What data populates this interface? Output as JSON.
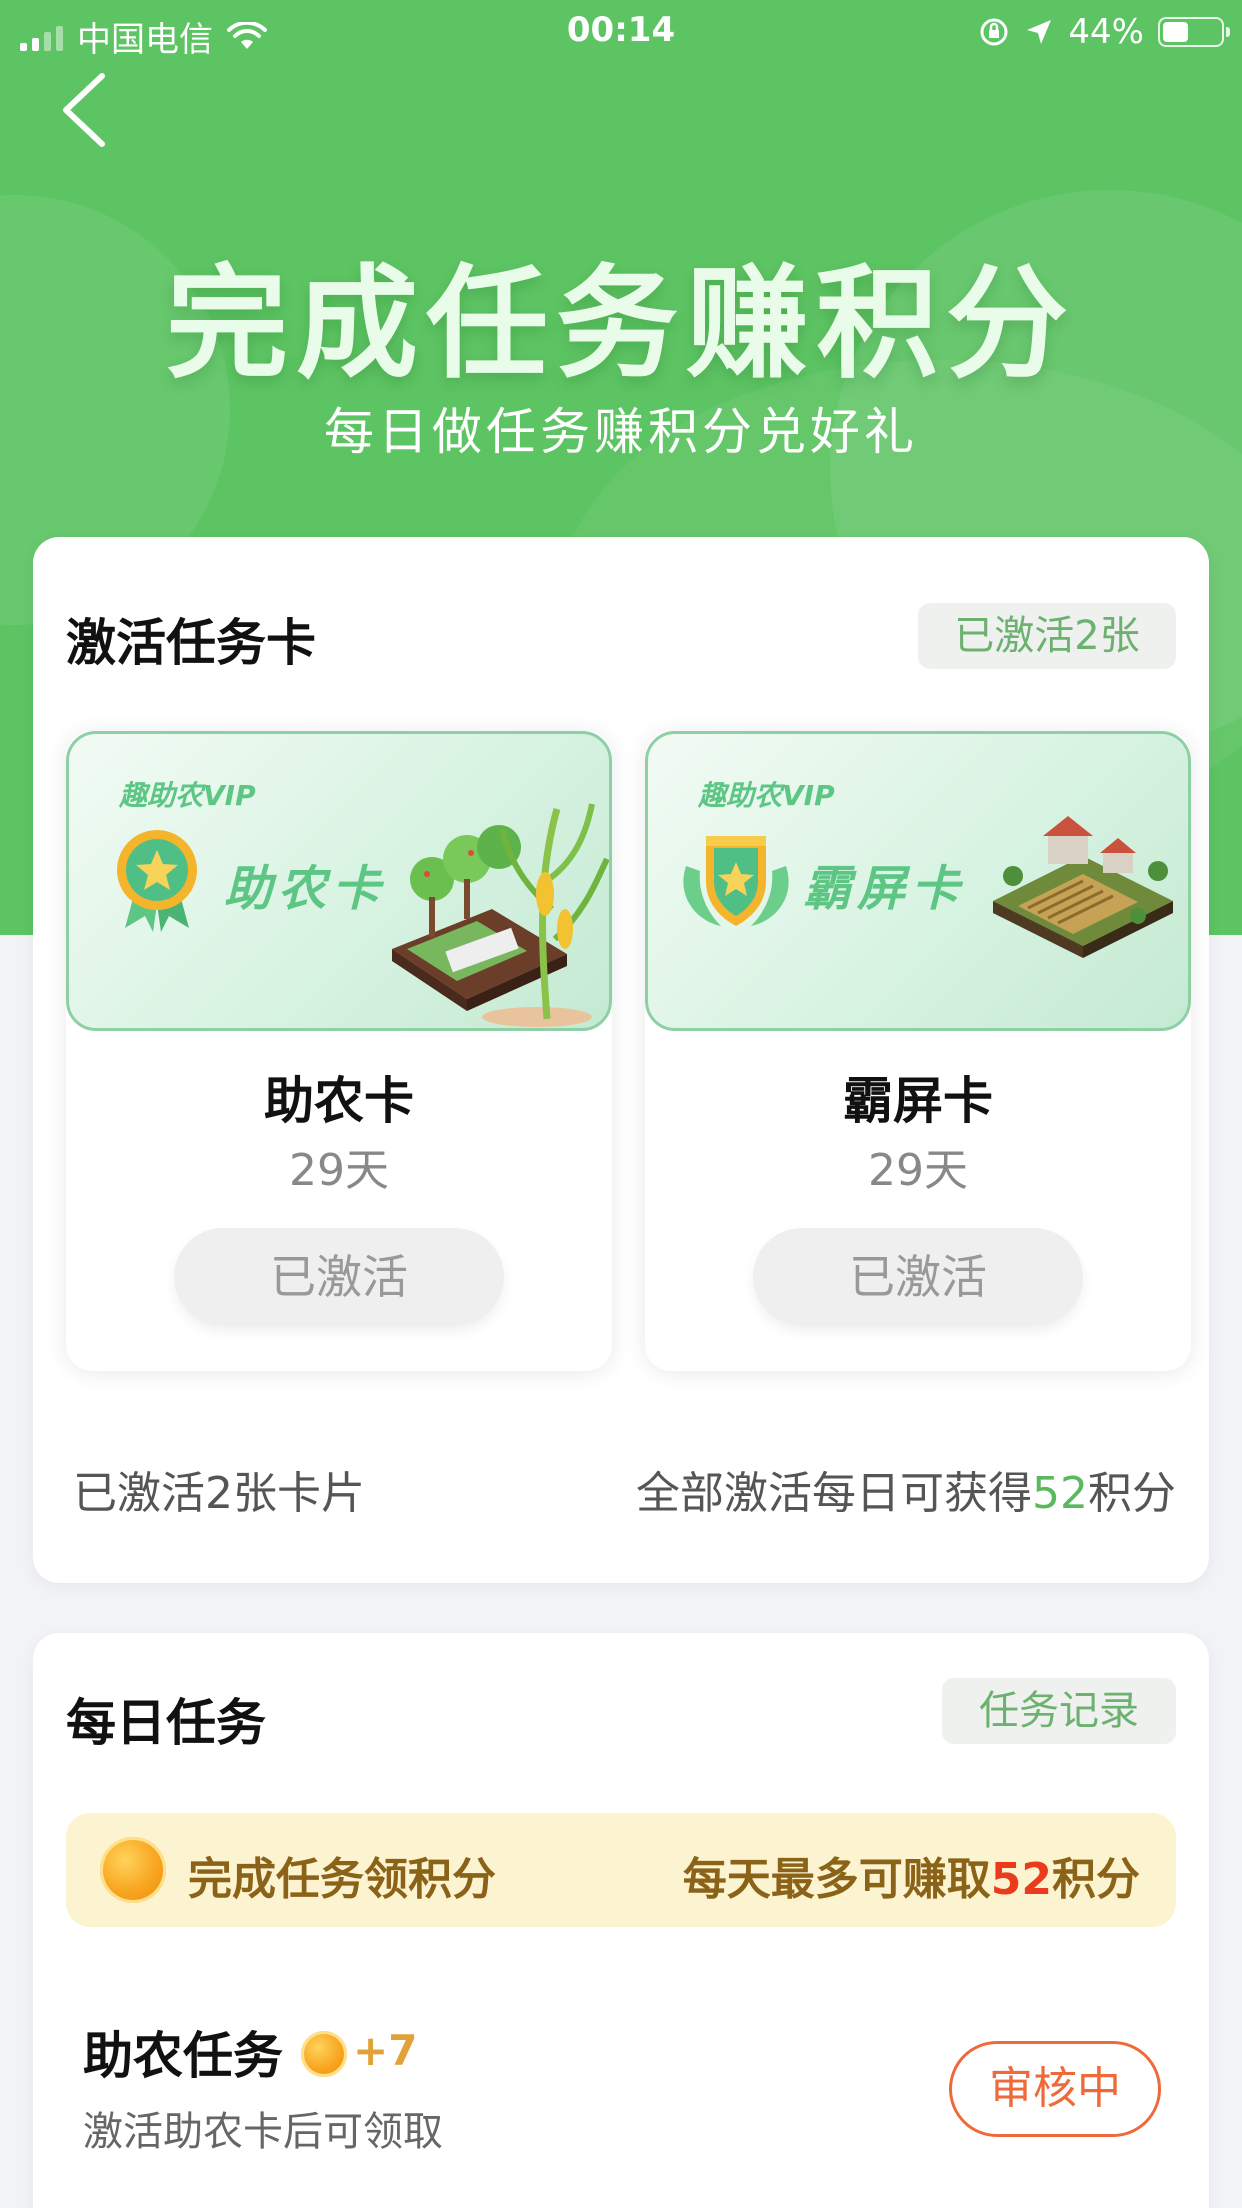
{
  "status_bar": {
    "carrier": "中国电信",
    "time": "00:14",
    "battery": "44%"
  },
  "hero": {
    "title": "完成任务赚积分",
    "subtitle": "每日做任务赚积分兑好礼"
  },
  "activate_section": {
    "title": "激活任务卡",
    "tag": "已激活2张",
    "cards": [
      {
        "vip_label": "趣助农VIP",
        "banner_name": "助农卡",
        "name": "助农卡",
        "days": "29天",
        "button": "已激活"
      },
      {
        "vip_label": "趣助农VIP",
        "banner_name": "霸屏卡",
        "name": "霸屏卡",
        "days": "29天",
        "button": "已激活"
      }
    ],
    "summary_left": "已激活2张卡片",
    "summary_right_prefix": "全部激活每日可获得",
    "summary_right_value": "52",
    "summary_right_suffix": "积分"
  },
  "daily_section": {
    "title": "每日任务",
    "tag": "任务记录",
    "banner_left": "完成任务领积分",
    "banner_right_prefix": "每天最多可赚取",
    "banner_right_value": "52",
    "banner_right_suffix": "积分",
    "tasks": [
      {
        "title": "助农任务",
        "points": "+7",
        "desc": "激活助农卡后可领取",
        "button": "审核中"
      }
    ]
  },
  "colors": {
    "brand_green": "#5dc463",
    "accent_orange": "#ef6a3a",
    "highlight_red": "#ec3a1c"
  }
}
